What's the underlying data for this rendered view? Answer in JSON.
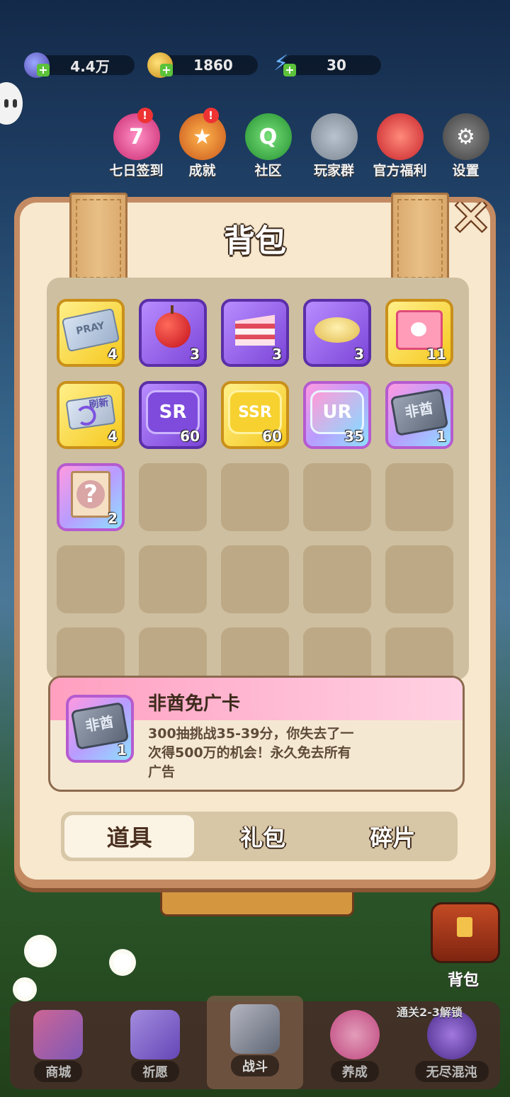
{
  "resources": [
    {
      "icon": "gem-icon",
      "value": "4.4万"
    },
    {
      "icon": "coin-icon",
      "value": "1860"
    },
    {
      "icon": "energy-bolt-icon",
      "value": "30"
    }
  ],
  "top_menu": [
    {
      "icon": "calendar-7-icon",
      "label": "七日签到",
      "glyph": "7",
      "badge": "!"
    },
    {
      "icon": "trophy-icon",
      "label": "成就",
      "glyph": "★",
      "badge": "!"
    },
    {
      "icon": "chat-bubble-icon",
      "label": "社区",
      "glyph": "Q",
      "badge": ""
    },
    {
      "icon": "penguin-icon",
      "label": "玩家群",
      "glyph": "",
      "badge": ""
    },
    {
      "icon": "gift-icon",
      "label": "官方福利",
      "glyph": "",
      "badge": ""
    },
    {
      "icon": "gear-icon",
      "label": "设置",
      "glyph": "⚙",
      "badge": ""
    }
  ],
  "panel": {
    "title": "背包",
    "close_glyph": "✕"
  },
  "items": [
    {
      "name": "pray-ticket",
      "frame": "gold",
      "icon": "pray-ticket-icon",
      "text": "PRAY",
      "qty": "4"
    },
    {
      "name": "apple",
      "frame": "purple",
      "icon": "apple-icon",
      "text": "",
      "qty": "3"
    },
    {
      "name": "cake",
      "frame": "purple",
      "icon": "cake-icon",
      "text": "",
      "qty": "3"
    },
    {
      "name": "chips",
      "frame": "purple",
      "icon": "chips-icon",
      "text": "",
      "qty": "3"
    },
    {
      "name": "pink-ticket",
      "frame": "gold",
      "icon": "ticket-icon",
      "text": "",
      "qty": "11"
    },
    {
      "name": "refresh-card",
      "frame": "gold",
      "icon": "refresh-card-icon",
      "text": "刷新",
      "qty": "4"
    },
    {
      "name": "sr-fragment",
      "frame": "purple",
      "icon": "sr-puzzle-icon",
      "text": "SR",
      "qty": "60"
    },
    {
      "name": "ssr-fragment",
      "frame": "gold",
      "icon": "ssr-puzzle-icon",
      "text": "SSR",
      "qty": "60"
    },
    {
      "name": "ur-fragment",
      "frame": "rainbow",
      "icon": "ur-puzzle-icon",
      "text": "UR",
      "qty": "35"
    },
    {
      "name": "feiyou-card",
      "frame": "rainbow",
      "icon": "feiyou-card-icon",
      "text": "非酋",
      "qty": "1"
    },
    {
      "name": "mystery-bag",
      "frame": "rainbow",
      "icon": "mystery-bag-icon",
      "text": "?",
      "qty": "2"
    }
  ],
  "empty_slots": 14,
  "detail": {
    "name": "非酋免广卡",
    "description": "300抽挑战35-39分，你失去了一次得500万的机会！永久免去所有广告",
    "icon": "feiyou-card-icon",
    "icon_text": "非酋",
    "qty": "1"
  },
  "tabs": [
    {
      "label": "道具",
      "active": true
    },
    {
      "label": "礼包",
      "active": false
    },
    {
      "label": "碎片",
      "active": false
    }
  ],
  "side_button": {
    "icon": "backpack-icon",
    "label": "背包"
  },
  "bottom_nav": [
    {
      "icon": "shop-icon",
      "label": "商城",
      "active": false
    },
    {
      "icon": "wish-card-icon",
      "label": "祈愿",
      "active": false
    },
    {
      "icon": "crossed-swords-icon",
      "label": "战斗",
      "active": true
    },
    {
      "icon": "paw-icon",
      "label": "养成",
      "active": false
    },
    {
      "icon": "lock-icon",
      "label": "无尽混沌",
      "active": false
    }
  ],
  "unlock_tip": "通关2-3解锁",
  "colors": {
    "panel_bg": "#f7e8ce",
    "panel_border": "#c48b62",
    "tab_active": "#fbf3e3",
    "detail_band": "#ffb8d2"
  }
}
